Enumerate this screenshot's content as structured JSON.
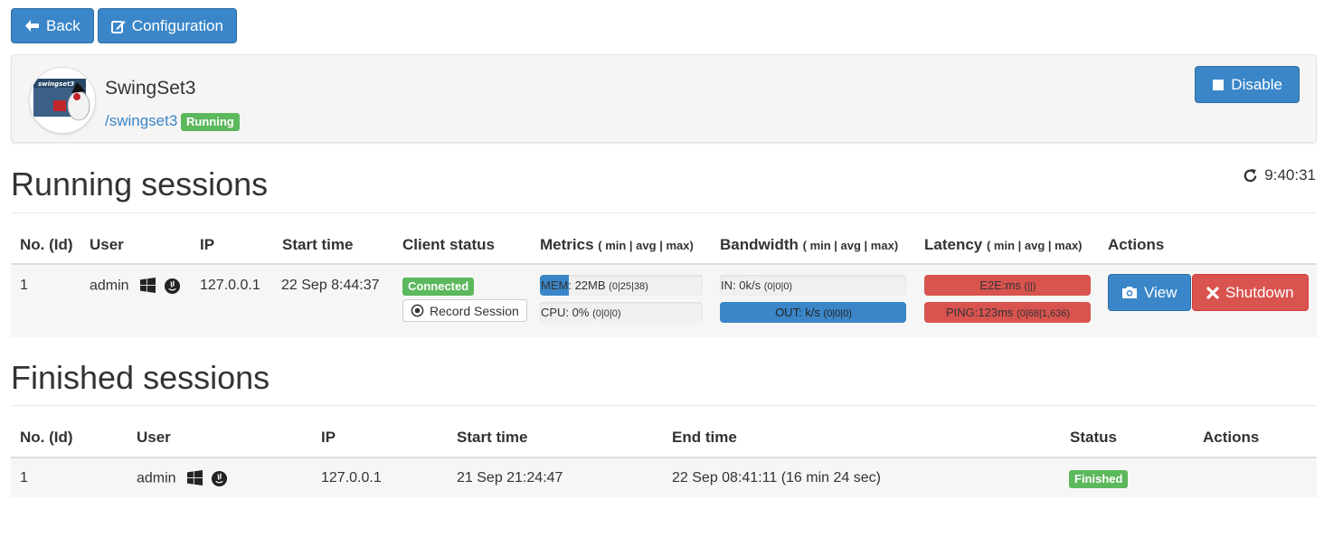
{
  "toolbar": {
    "back_label": "Back",
    "config_label": "Configuration"
  },
  "app": {
    "name": "SwingSet3",
    "path": "/swingset3",
    "status": "Running",
    "disable_label": "Disable",
    "logo_text": "swingset 3"
  },
  "running": {
    "title": "Running sessions",
    "refresh_time": "9:40:31",
    "headers": {
      "no": "No. (Id)",
      "user": "User",
      "ip": "IP",
      "start": "Start time",
      "client_status": "Client status",
      "metrics": "Metrics",
      "bandwidth": "Bandwidth",
      "latency": "Latency",
      "stat_suffix": "( min | avg | max)",
      "actions": "Actions"
    },
    "row": {
      "no": "1",
      "user": "admin",
      "ip": "127.0.0.1",
      "start": "22 Sep 8:44:37",
      "client_status": "Connected",
      "record_label": "Record Session",
      "mem_label": "MEM:",
      "mem_value": "22MB",
      "mem_stats": "(0|25|38)",
      "mem_fill": 0.18,
      "cpu_label": "CPU: 0%",
      "cpu_stats": "(0|0|0)",
      "in_label": "IN: 0k/s",
      "in_stats": "(0|0|0)",
      "out_label": "OUT: k/s",
      "out_stats": "(0|0|0)",
      "e2e_label": "E2E:ms",
      "e2e_stats": "(||)",
      "ping_label": "PING:123ms",
      "ping_stats": "(0|68|1,636)",
      "view_label": "View",
      "shutdown_label": "Shutdown"
    }
  },
  "finished": {
    "title": "Finished sessions",
    "headers": {
      "no": "No. (Id)",
      "user": "User",
      "ip": "IP",
      "start": "Start time",
      "end": "End time",
      "status": "Status",
      "actions": "Actions"
    },
    "row": {
      "no": "1",
      "user": "admin",
      "ip": "127.0.0.1",
      "start": "21 Sep 21:24:47",
      "end": "22 Sep 08:41:11 (16 min 24 sec)",
      "status": "Finished"
    }
  },
  "colors": {
    "primary": "#3a86c8",
    "danger": "#d9534f",
    "success": "#5cb85c",
    "panel": "#f5f5f5"
  },
  "icons": [
    "arrow-left-icon",
    "edit-icon",
    "stop-icon",
    "refresh-icon",
    "windows-icon",
    "java-icon",
    "record-icon",
    "camera-icon",
    "close-icon"
  ]
}
